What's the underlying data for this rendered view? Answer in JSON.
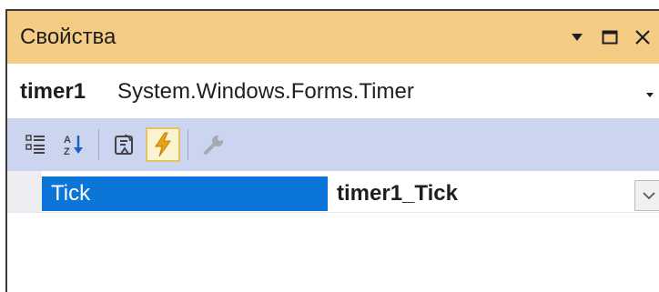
{
  "panel": {
    "title": "Свойства"
  },
  "title_controls": [
    {
      "name": "window-position-dropdown",
      "icon": "dropdown-triangle-icon"
    },
    {
      "name": "maximize-button",
      "icon": "maximize-icon"
    },
    {
      "name": "close-button",
      "icon": "close-icon"
    }
  ],
  "object_selector": {
    "name": "timer1",
    "type": "System.Windows.Forms.Timer"
  },
  "toolbar": {
    "buttons": [
      {
        "name": "categorized-button",
        "icon": "categorized-icon",
        "active": false
      },
      {
        "name": "alphabetical-button",
        "icon": "sort-alphabetical-icon",
        "active": false
      },
      {
        "name": "properties-button",
        "icon": "properties-icon",
        "active": false
      },
      {
        "name": "events-button",
        "icon": "lightning-icon",
        "active": true
      },
      {
        "name": "property-pages-button",
        "icon": "wrench-icon",
        "active": false,
        "disabled": true
      }
    ]
  },
  "events": [
    {
      "name": "Tick",
      "value": "timer1_Tick",
      "selected": true
    }
  ],
  "colors": {
    "title_bar": "#f5cc84",
    "toolbar": "#ccd5f0",
    "selection": "#0b76d8",
    "active_button_bg": "#fcf4d0",
    "active_button_border": "#e5c365",
    "lightning": "#e8a21a"
  }
}
